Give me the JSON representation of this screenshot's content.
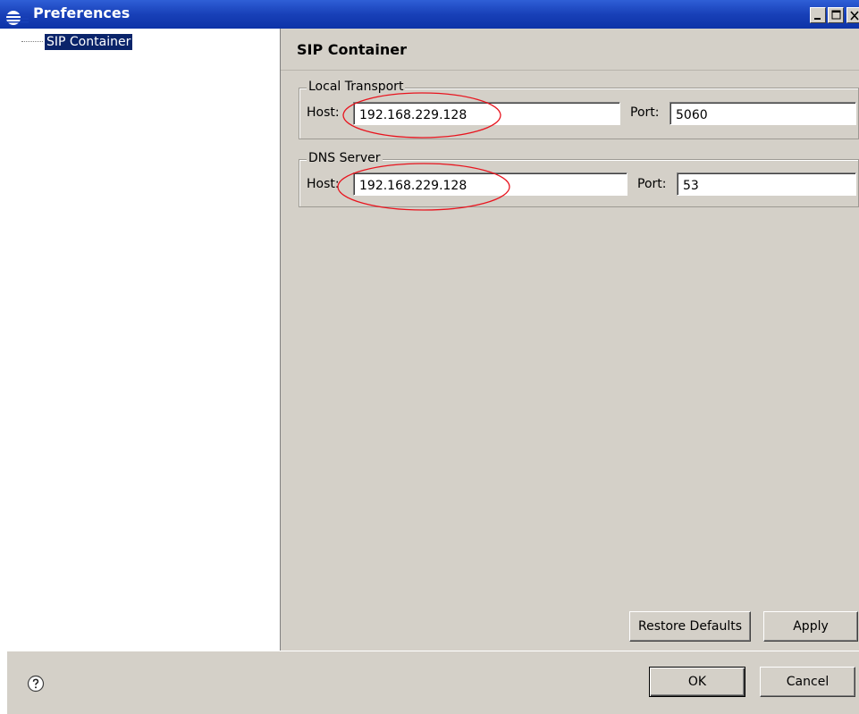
{
  "window": {
    "title": "Preferences"
  },
  "tree": {
    "items": [
      {
        "label": "SIP Container",
        "selected": true
      }
    ]
  },
  "page": {
    "title": "SIP Container"
  },
  "local_transport": {
    "legend": "Local Transport",
    "host_label": "Host:",
    "host_value": "192.168.229.128",
    "port_label": "Port:",
    "port_value": "5060"
  },
  "dns_server": {
    "legend": "DNS Server",
    "host_label": "Host:",
    "host_value": "192.168.229.128",
    "port_label": "Port:",
    "port_value": "53"
  },
  "buttons": {
    "restore_defaults": "Restore Defaults",
    "apply": "Apply",
    "ok": "OK",
    "cancel": "Cancel"
  },
  "colors": {
    "selection": "#0a246a",
    "annotation": "#e8141e",
    "titlebar": "#1840b8",
    "panel": "#d4d0c8"
  }
}
